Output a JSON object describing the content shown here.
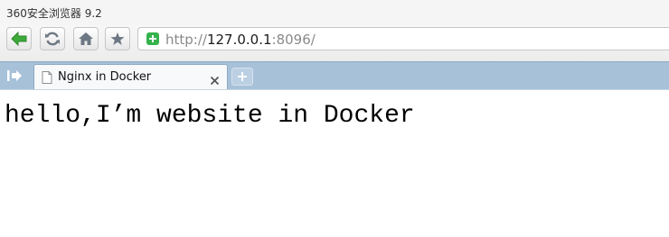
{
  "window": {
    "title": "360安全浏览器 9.2"
  },
  "toolbar": {
    "back_icon": "back-arrow-icon",
    "refresh_icon": "refresh-icon",
    "home_icon": "home-icon",
    "favorite_icon": "star-icon",
    "url_scheme": "http://",
    "url_host": "127.0.0.1",
    "url_rest": ":8096/",
    "security_icon": "shield-plus-icon",
    "accent_color": "#35b24b"
  },
  "tabs": [
    {
      "label": "Nginx in Docker",
      "icon": "document-icon",
      "active": true
    }
  ],
  "tabstrip": {
    "sidebar_icon": "sidebar-toggle-icon",
    "new_tab_icon": "plus-icon",
    "background_color": "#a7c1d9"
  },
  "page": {
    "text": "hello,I’m website in Docker"
  }
}
